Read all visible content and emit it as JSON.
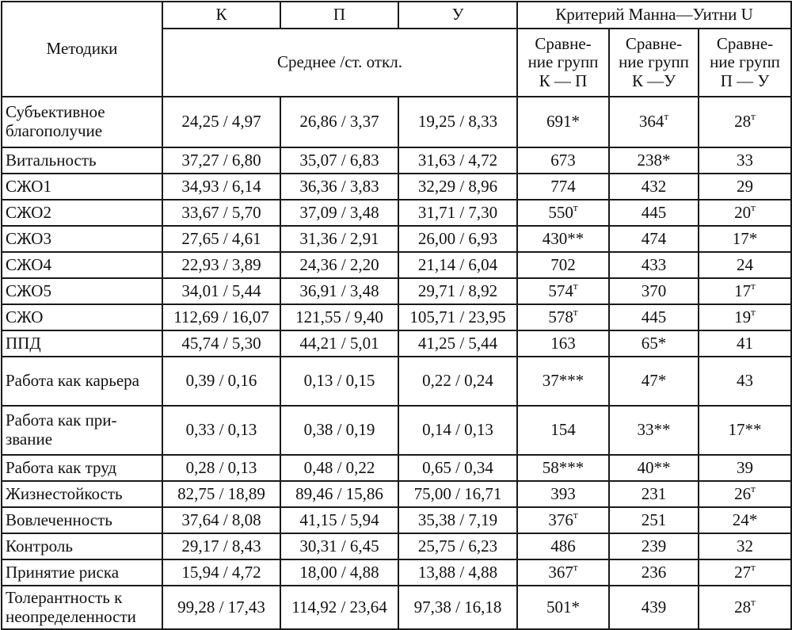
{
  "header": {
    "methods": "Методики",
    "groups": [
      "К",
      "П",
      "У"
    ],
    "mann_whitney": "Критерий Манна—Уитни U",
    "mean_sd": "Среднее /ст. откл.",
    "comparisons": [
      {
        "line1": "Сравне-",
        "line2": "ние групп",
        "line3": "К — П"
      },
      {
        "line1": "Сравне-",
        "line2": "ние групп",
        "line3": "К —У"
      },
      {
        "line1": "Сравне-",
        "line2": "ние групп",
        "line3": "П — У"
      }
    ]
  },
  "rows": [
    {
      "name": "Субъективное благополучие",
      "k": "24,25 / 4,97",
      "p": "26,86 / 3,37",
      "u": "19,25 / 8,33",
      "kp": "691*",
      "kp_sup": "",
      "ku": "364",
      "ku_sup": "т",
      "pu": "28",
      "pu_sup": "т"
    },
    {
      "name": "Витальность",
      "k": "37,27 / 6,80",
      "p": "35,07 / 6,83",
      "u": "31,63 / 4,72",
      "kp": "673",
      "kp_sup": "",
      "ku": "238*",
      "ku_sup": "",
      "pu": "33",
      "pu_sup": ""
    },
    {
      "name": "СЖО1",
      "k": "34,93 / 6,14",
      "p": "36,36 / 3,83",
      "u": "32,29 / 8,96",
      "kp": "774",
      "kp_sup": "",
      "ku": "432",
      "ku_sup": "",
      "pu": "29",
      "pu_sup": ""
    },
    {
      "name": "СЖО2",
      "k": "33,67 / 5,70",
      "p": "37,09 / 3,48",
      "u": "31,71 / 7,30",
      "kp": "550",
      "kp_sup": "т",
      "ku": "445",
      "ku_sup": "",
      "pu": "20",
      "pu_sup": "т"
    },
    {
      "name": "СЖО3",
      "k": "27,65 / 4,61",
      "p": "31,36 / 2,91",
      "u": "26,00 / 6,93",
      "kp": "430**",
      "kp_sup": "",
      "ku": "474",
      "ku_sup": "",
      "pu": "17*",
      "pu_sup": ""
    },
    {
      "name": "СЖО4",
      "k": "22,93 / 3,89",
      "p": "24,36 / 2,20",
      "u": "21,14 / 6,04",
      "kp": "702",
      "kp_sup": "",
      "ku": "433",
      "ku_sup": "",
      "pu": "24",
      "pu_sup": ""
    },
    {
      "name": "СЖО5",
      "k": "34,01 / 5,44",
      "p": "36,91 / 3,48",
      "u": "29,71 / 8,92",
      "kp": "574",
      "kp_sup": "т",
      "ku": "370",
      "ku_sup": "",
      "pu": "17",
      "pu_sup": "т"
    },
    {
      "name": "СЖО",
      "k": "112,69 / 16,07",
      "p": "121,55 / 9,40",
      "u": "105,71 / 23,95",
      "kp": "578",
      "kp_sup": "т",
      "ku": "445",
      "ku_sup": "",
      "pu": "19",
      "pu_sup": "т"
    },
    {
      "name": "ППД",
      "k": "45,74 / 5,30",
      "p": "44,21 / 5,01",
      "u": "41,25 / 5,44",
      "kp": "163",
      "kp_sup": "",
      "ku": "65*",
      "ku_sup": "",
      "pu": "41",
      "pu_sup": ""
    },
    {
      "name": "Работа как карьера",
      "k": "0,39 / 0,16",
      "p": "0,13 / 0,15",
      "u": "0,22 / 0,24",
      "kp": "37***",
      "kp_sup": "",
      "ku": "47*",
      "ku_sup": "",
      "pu": "43",
      "pu_sup": ""
    },
    {
      "name": "Работа как при-звание",
      "k": "0,33 / 0,13",
      "p": "0,38 / 0,19",
      "u": "0,14 / 0,13",
      "kp": "154",
      "kp_sup": "",
      "ku": "33**",
      "ku_sup": "",
      "pu": "17**",
      "pu_sup": ""
    },
    {
      "name": "Работа как труд",
      "k": "0,28 / 0,13",
      "p": "0,48 / 0,22",
      "u": "0,65 / 0,34",
      "kp": "58***",
      "kp_sup": "",
      "ku": "40**",
      "ku_sup": "",
      "pu": "39",
      "pu_sup": ""
    },
    {
      "name": "Жизнестойкость",
      "k": "82,75 / 18,89",
      "p": "89,46 / 15,86",
      "u": "75,00 / 16,71",
      "kp": "393",
      "kp_sup": "",
      "ku": "231",
      "ku_sup": "",
      "pu": "26",
      "pu_sup": "т"
    },
    {
      "name": "Вовлеченность",
      "k": "37,64 / 8,08",
      "p": "41,15 / 5,94",
      "u": "35,38 / 7,19",
      "kp": "376",
      "kp_sup": "т",
      "ku": "251",
      "ku_sup": "",
      "pu": "24*",
      "pu_sup": ""
    },
    {
      "name": "Контроль",
      "k": "29,17 / 8,43",
      "p": "30,31 / 6,45",
      "u": "25,75 / 6,23",
      "kp": "486",
      "kp_sup": "",
      "ku": "239",
      "ku_sup": "",
      "pu": "32",
      "pu_sup": ""
    },
    {
      "name": "Принятие риска",
      "k": "15,94 / 4,72",
      "p": "18,00 / 4,88",
      "u": "13,88 / 4,88",
      "kp": "367",
      "kp_sup": "т",
      "ku": "236",
      "ku_sup": "",
      "pu": "27",
      "pu_sup": "т"
    },
    {
      "name": "Толерантность к неопределенности",
      "k": "99,28 / 17,43",
      "p": "114,92 / 23,64",
      "u": "97,38 / 16,18",
      "kp": "501*",
      "kp_sup": "",
      "ku": "439",
      "ku_sup": "",
      "pu": "28",
      "pu_sup": "т"
    }
  ]
}
